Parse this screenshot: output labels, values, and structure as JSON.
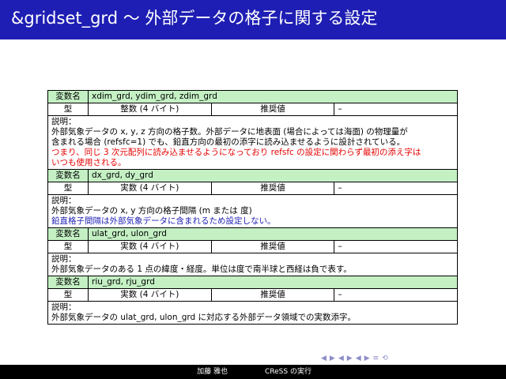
{
  "slide": {
    "title": "&gridset_grd 〜 外部データの格子に関する設定"
  },
  "table": {
    "label_var": "変数名",
    "label_type": "型",
    "label_default": "推奨値",
    "label_desc": "説明：",
    "rows": [
      {
        "var": "xdim_grd, ydim_grd, zdim_grd",
        "type": "整数 (4 バイト)",
        "default": "–",
        "lines": [
          {
            "text": "外部気象データの x, y, z 方向の格子数。外部データに地表面 (場合によっては海面) の物理量が",
            "color": "black"
          },
          {
            "text": "含まれる場合 (refsfc=1) でも、鉛直方向の最初の添字に読み込ませるように設計されている。",
            "color": "black"
          },
          {
            "text": "つまり、同じ 3 次元配列に読み込ませるようになっており refsfc の設定に関わらず最初の添え字は",
            "color": "red"
          },
          {
            "text": "いつも使用される。",
            "color": "red"
          }
        ]
      },
      {
        "var": "dx_grd, dy_grd",
        "type": "実数 (4 バイト)",
        "default": "–",
        "lines": [
          {
            "text": "外部気象データの x, y 方向の格子間隔 (m または 度)",
            "color": "black"
          },
          {
            "text": "鉛直格子間隔は外部気象データに含まれるため設定しない。",
            "color": "blue"
          }
        ]
      },
      {
        "var": "ulat_grd, ulon_grd",
        "type": "実数 (4 バイト)",
        "default": "–",
        "lines": [
          {
            "text": "外部気象データのある 1 点の緯度・経度。単位は度で南半球と西経は負で表す。",
            "color": "black"
          }
        ]
      },
      {
        "var": "riu_grd, rju_grd",
        "type": "実数 (4 バイト)",
        "default": "–",
        "lines": [
          {
            "text": "外部気象データの ulat_grd, ulon_grd に対応する外部データ領域での実数添字。",
            "color": "black"
          }
        ]
      }
    ]
  },
  "footer": {
    "author": "加藤 雅也",
    "subtitle": "CReSS の実行"
  },
  "nav": {
    "icons": [
      "nav-frame-prev-icon",
      "nav-frame-next-icon",
      "nav-subsection-prev-icon",
      "nav-subsection-next-icon",
      "nav-section-prev-icon",
      "nav-section-next-icon",
      "nav-align-icon",
      "nav-search-icon"
    ],
    "glyphs": [
      "◀",
      "▶",
      "◀",
      "▶",
      "◀",
      "▶",
      "≡",
      "⟲"
    ]
  },
  "colors": {
    "header_bg": "#1e1eb4",
    "var_row_bg": "#c4f0c4",
    "red_text": "#e60000",
    "blue_text": "#1e1eb4"
  }
}
